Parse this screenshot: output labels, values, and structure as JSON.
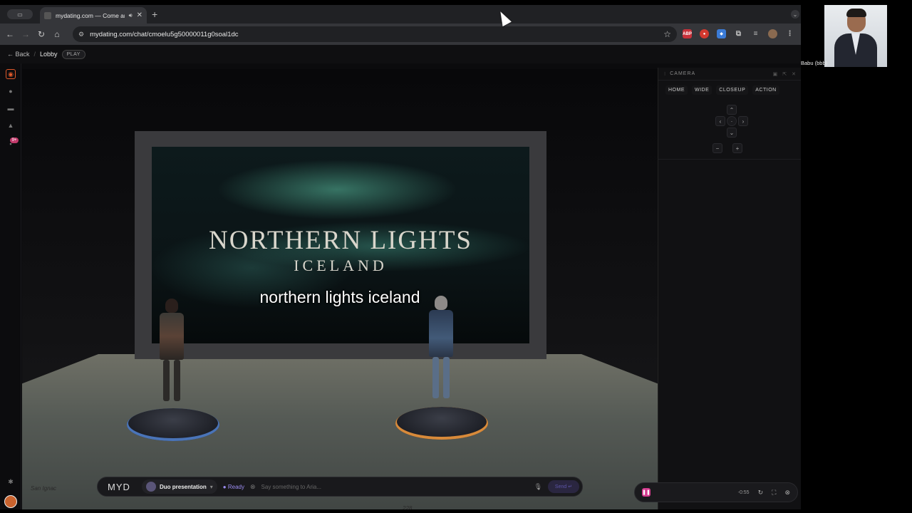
{
  "browser": {
    "tab_title": "mydating.com — Come and",
    "new_tab": "+",
    "url": "mydating.com/chat/cmoelu5g50000011g0soal1dc"
  },
  "appbar": {
    "back_label": "← Back",
    "separator": "/",
    "crumb": "Lobby",
    "badge": "PLAY"
  },
  "rail": {
    "notification_count": "9+"
  },
  "stage": {
    "screen_title": "NORTHERN LIGHTS",
    "screen_subtitle": "ICELAND",
    "caption": "northern lights iceland",
    "map_labels": [
      "San Ignac",
      "228"
    ]
  },
  "chatbar": {
    "logo": "MYD",
    "mode_label": "Duo presentation",
    "status": "Ready",
    "placeholder": "Say something to Aria...",
    "send_label": "Send ↵"
  },
  "camera_panel": {
    "title": "CAMERA",
    "presets": [
      "HOME",
      "WIDE",
      "CLOSEUP",
      "ACTION"
    ]
  },
  "player": {
    "time": "-0:55"
  },
  "video": {
    "participant_name": "Babu (bbb)"
  },
  "colors": {
    "accent_orange": "#e05a2b",
    "accent_purple": "#9b8cf0",
    "pause_pink": "#d43a8e",
    "pedestal_blue": "#4a74b8",
    "pedestal_orange": "#d88a3a"
  }
}
